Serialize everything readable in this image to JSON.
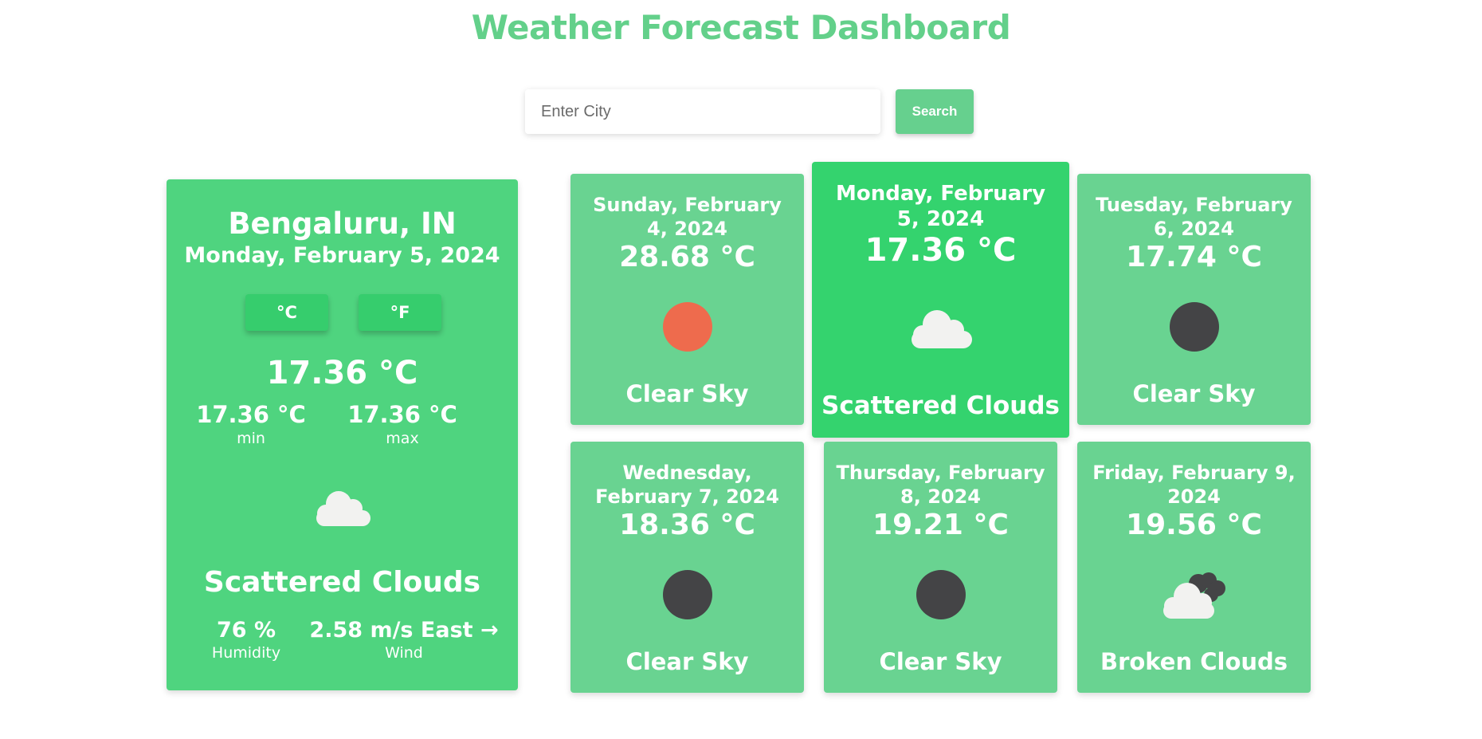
{
  "header": {
    "title": "Weather Forecast Dashboard"
  },
  "search": {
    "placeholder": "Enter City",
    "value": "",
    "button_label": "Search"
  },
  "current": {
    "city": "Bengaluru, IN",
    "date": "Monday, February 5, 2024",
    "unit_celsius_label": "°C",
    "unit_fahrenheit_label": "°F",
    "temperature": "17.36 °C",
    "min_value": "17.36 °C",
    "min_label": "min",
    "max_value": "17.36 °C",
    "max_label": "max",
    "icon": "cloud-icon",
    "description": "Scattered Clouds",
    "humidity_value": "76 %",
    "humidity_label": "Humidity",
    "wind_value": "2.58 m/s East →",
    "wind_label": "Wind"
  },
  "forecast": [
    {
      "date": "Sunday, February 4, 2024",
      "temperature": "28.68 °C",
      "icon": "sun-icon",
      "description": "Clear Sky",
      "active": false
    },
    {
      "date": "Monday, February 5, 2024",
      "temperature": "17.36 °C",
      "icon": "cloud-icon",
      "description": "Scattered Clouds",
      "active": true
    },
    {
      "date": "Tuesday, February 6, 2024",
      "temperature": "17.74 °C",
      "icon": "moon-icon",
      "description": "Clear Sky",
      "active": false
    },
    {
      "date": "Wednesday, February 7, 2024",
      "temperature": "18.36 °C",
      "icon": "moon-icon",
      "description": "Clear Sky",
      "active": false
    },
    {
      "date": "Thursday, February 8, 2024",
      "temperature": "19.21 °C",
      "icon": "moon-icon",
      "description": "Clear Sky",
      "active": false
    },
    {
      "date": "Friday, February 9, 2024",
      "temperature": "19.56 °C",
      "icon": "broken-clouds-icon",
      "description": "Broken Clouds",
      "active": false
    }
  ],
  "colors": {
    "accent": "#63d08a",
    "current_card": "#4fd47f",
    "forecast_card": "#69d391",
    "forecast_card_active": "#34d36e",
    "sun": "#ee6b4d",
    "night": "#444446",
    "cloud": "#f2f2f0"
  }
}
